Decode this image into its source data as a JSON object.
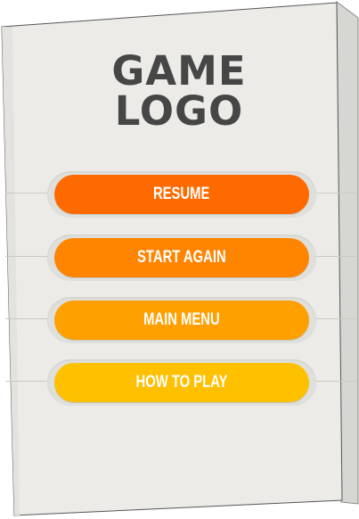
{
  "logo": {
    "line1": "GAME",
    "line2": "LOGO"
  },
  "menu": {
    "items": [
      {
        "label": "RESUME",
        "color": "#ff6a00"
      },
      {
        "label": "START AGAIN",
        "color": "#ff8400"
      },
      {
        "label": "MAIN MENU",
        "color": "#ffa000"
      },
      {
        "label": "HOW TO PLAY",
        "color": "#ffc000"
      }
    ]
  },
  "colors": {
    "panel": "#ecebe8",
    "panel_shade": "#d9d9d6",
    "logo_text": "#464646"
  }
}
